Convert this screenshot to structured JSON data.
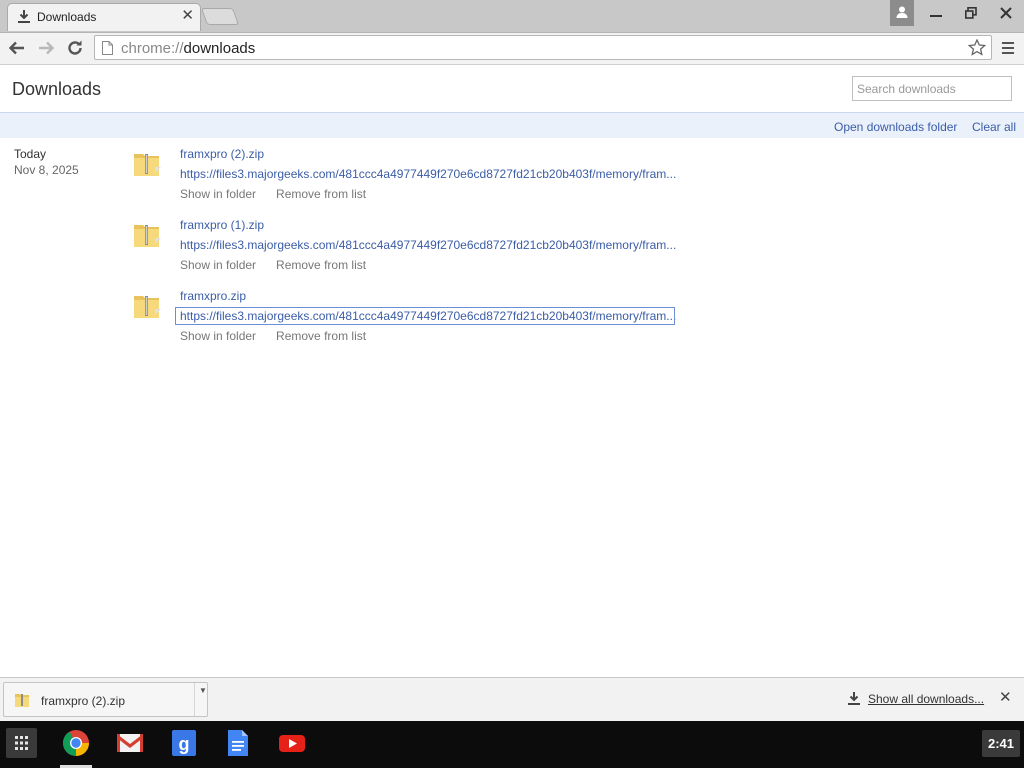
{
  "window": {
    "tab_title": "Downloads",
    "tab_icon": "download-icon"
  },
  "toolbar": {
    "url_scheme": "chrome://",
    "url_host": "downloads"
  },
  "page": {
    "title": "Downloads",
    "search_placeholder": "Search downloads",
    "open_folder_label": "Open downloads folder",
    "clear_all_label": "Clear all"
  },
  "date_group": {
    "day": "Today",
    "date": "Nov 8, 2025"
  },
  "downloads": [
    {
      "name": "framxpro (2).zip",
      "url": "https://files3.majorgeeks.com/481ccc4a4977449f270e6cd8727fd21cb20b403f/memory/fram...",
      "show_in_folder": "Show in folder",
      "remove": "Remove from list"
    },
    {
      "name": "framxpro (1).zip",
      "url": "https://files3.majorgeeks.com/481ccc4a4977449f270e6cd8727fd21cb20b403f/memory/fram...",
      "show_in_folder": "Show in folder",
      "remove": "Remove from list"
    },
    {
      "name": "framxpro.zip",
      "url": "https://files3.majorgeeks.com/481ccc4a4977449f270e6cd8727fd21cb20b403f/memory/fram...",
      "show_in_folder": "Show in folder",
      "remove": "Remove from list"
    }
  ],
  "shelf": {
    "item_name": "framxpro (2).zip",
    "show_all_label": "Show all downloads..."
  },
  "taskbar": {
    "apps": [
      "chrome-icon",
      "gmail-icon",
      "google-search-icon",
      "docs-icon",
      "youtube-icon"
    ],
    "clock": "2:41"
  },
  "colors": {
    "link": "#3b5da8",
    "actionbar_bg": "#eaf1fb",
    "taskbar_bg": "#0c0c0c"
  }
}
